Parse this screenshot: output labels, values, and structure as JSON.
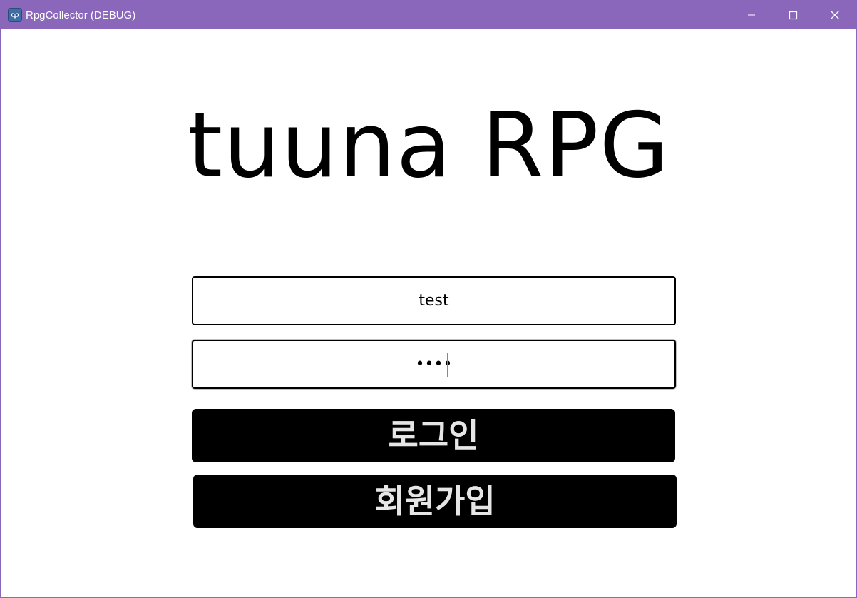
{
  "window": {
    "title": "RpgCollector (DEBUG)",
    "icon": "godot-engine-icon",
    "titlebar_color": "#8b67bc",
    "controls": [
      "minimize-icon",
      "maximize-icon",
      "close-icon"
    ]
  },
  "main": {
    "game_title": "tuuna RPG",
    "username_value": "test",
    "password_value": "test",
    "login_label": "로그인",
    "signup_label": "회원가입"
  }
}
